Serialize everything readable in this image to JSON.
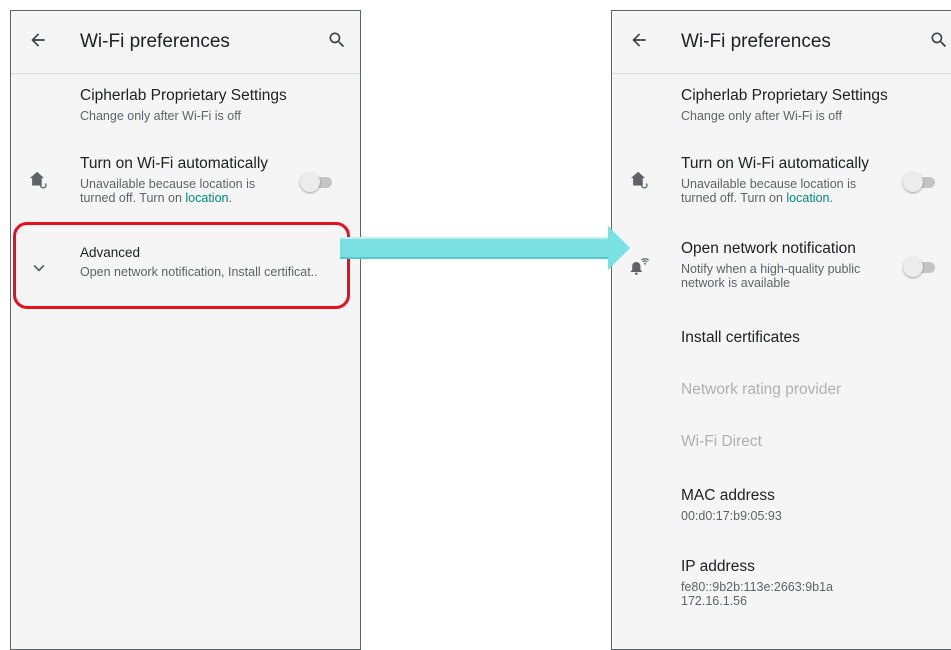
{
  "colors": {
    "accent_link": "#00897b",
    "highlight": "#e8101d",
    "arrow": "#7adfe0",
    "switch_off_track": "#c4c4c4",
    "disabled_text": "#b0b0b0"
  },
  "left_screen": {
    "header": {
      "title": "Wi-Fi preferences",
      "back_icon": "arrow-back-icon",
      "search_icon": "search-icon"
    },
    "proprietary": {
      "title": "Cipherlab Proprietary Settings",
      "summary": "Change only after Wi-Fi is off"
    },
    "auto_wifi": {
      "icon": "home-wifi-icon",
      "title": "Turn on Wi-Fi automatically",
      "summary_line1": "Unavailable because location is",
      "summary_line2_prefix": "turned off. Turn on ",
      "summary_link": "location",
      "summary_line2_suffix": ".",
      "toggle_on": false
    },
    "advanced": {
      "icon": "chevron-down-icon",
      "title": "Advanced",
      "summary": "Open network notification, Install certificat.."
    }
  },
  "right_screen": {
    "header": {
      "title": "Wi-Fi preferences",
      "back_icon": "arrow-back-icon",
      "search_icon": "search-icon"
    },
    "proprietary": {
      "title": "Cipherlab Proprietary Settings",
      "summary": "Change only after Wi-Fi is off"
    },
    "auto_wifi": {
      "icon": "home-wifi-icon",
      "title": "Turn on Wi-Fi automatically",
      "summary_line1": "Unavailable because location is",
      "summary_line2_prefix": "turned off. Turn on ",
      "summary_link": "location",
      "summary_line2_suffix": ".",
      "toggle_on": false
    },
    "open_network": {
      "icon": "notification-wifi-icon",
      "title": "Open network notification",
      "summary_line1": "Notify when a high-quality public",
      "summary_line2": "network is available",
      "toggle_on": false
    },
    "install_certificates": {
      "title": "Install certificates"
    },
    "network_rating": {
      "title": "Network rating provider",
      "enabled": false
    },
    "wifi_direct": {
      "title": "Wi-Fi Direct",
      "enabled": false
    },
    "mac_address": {
      "title": "MAC address",
      "value": "00:d0:17:b9:05:93"
    },
    "ip_address": {
      "title": "IP address",
      "value_line1": "fe80::9b2b:113e:2663:9b1a",
      "value_line2": "172.16.1.56"
    }
  },
  "annotation": {
    "highlight_target": "advanced",
    "arrow_icon": "right-arrow-icon"
  }
}
